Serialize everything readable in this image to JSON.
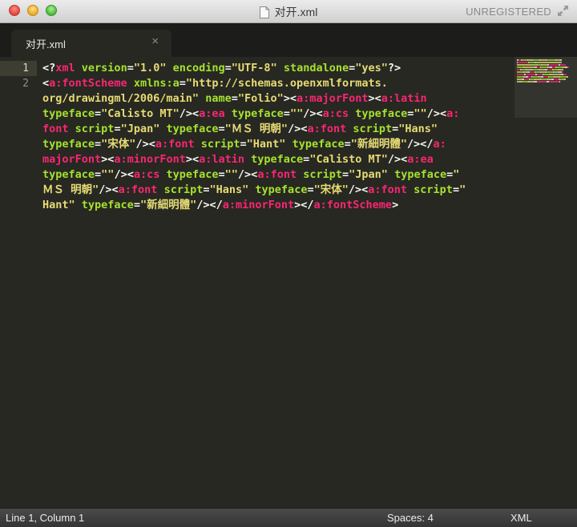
{
  "window": {
    "title": "对开.xml",
    "registration": "UNREGISTERED"
  },
  "tab": {
    "label": "对开.xml",
    "close_glyph": "×"
  },
  "gutter": {
    "line_numbers": [
      "1",
      "2"
    ]
  },
  "code": {
    "lines": [
      [
        [
          "punc",
          "<?"
        ],
        [
          "tag",
          "xml"
        ],
        [
          "punc",
          " "
        ],
        [
          "attr",
          "version"
        ],
        [
          "punc",
          "="
        ],
        [
          "str",
          "\"1.0\""
        ],
        [
          "punc",
          " "
        ],
        [
          "attr",
          "encoding"
        ],
        [
          "punc",
          "="
        ],
        [
          "str",
          "\"UTF-8\""
        ],
        [
          "punc",
          " "
        ],
        [
          "attr",
          "standalone"
        ],
        [
          "punc",
          "="
        ],
        [
          "str",
          "\"yes\""
        ],
        [
          "punc",
          "?>"
        ]
      ],
      [
        [
          "punc",
          "<"
        ],
        [
          "tag",
          "a:fontScheme"
        ],
        [
          "punc",
          " "
        ],
        [
          "attr",
          "xmlns:a"
        ],
        [
          "punc",
          "="
        ],
        [
          "str",
          "\"http://schemas.openxmlformats."
        ]
      ],
      [
        [
          "str",
          "org/drawingml/2006/main\""
        ],
        [
          "punc",
          " "
        ],
        [
          "attr",
          "name"
        ],
        [
          "punc",
          "="
        ],
        [
          "str",
          "\"Folio\""
        ],
        [
          "punc",
          "><"
        ],
        [
          "tag",
          "a:majorFont"
        ],
        [
          "punc",
          "><"
        ],
        [
          "tag",
          "a:latin"
        ]
      ],
      [
        [
          "attr",
          "typeface"
        ],
        [
          "punc",
          "="
        ],
        [
          "str",
          "\"Calisto MT\""
        ],
        [
          "punc",
          "/><"
        ],
        [
          "tag",
          "a:ea"
        ],
        [
          "punc",
          " "
        ],
        [
          "attr",
          "typeface"
        ],
        [
          "punc",
          "="
        ],
        [
          "str",
          "\"\""
        ],
        [
          "punc",
          "/><"
        ],
        [
          "tag",
          "a:cs"
        ],
        [
          "punc",
          " "
        ],
        [
          "attr",
          "typeface"
        ],
        [
          "punc",
          "="
        ],
        [
          "str",
          "\"\""
        ],
        [
          "punc",
          "/><"
        ],
        [
          "tag",
          "a:"
        ]
      ],
      [
        [
          "tag",
          "font"
        ],
        [
          "punc",
          " "
        ],
        [
          "attr",
          "script"
        ],
        [
          "punc",
          "="
        ],
        [
          "str",
          "\"Jpan\""
        ],
        [
          "punc",
          " "
        ],
        [
          "attr",
          "typeface"
        ],
        [
          "punc",
          "="
        ],
        [
          "str",
          "\"ＭＳ 明朝\""
        ],
        [
          "punc",
          "/><"
        ],
        [
          "tag",
          "a:font"
        ],
        [
          "punc",
          " "
        ],
        [
          "attr",
          "script"
        ],
        [
          "punc",
          "="
        ],
        [
          "str",
          "\"Hans\""
        ]
      ],
      [
        [
          "attr",
          "typeface"
        ],
        [
          "punc",
          "="
        ],
        [
          "str",
          "\"宋体\""
        ],
        [
          "punc",
          "/><"
        ],
        [
          "tag",
          "a:font"
        ],
        [
          "punc",
          " "
        ],
        [
          "attr",
          "script"
        ],
        [
          "punc",
          "="
        ],
        [
          "str",
          "\"Hant\""
        ],
        [
          "punc",
          " "
        ],
        [
          "attr",
          "typeface"
        ],
        [
          "punc",
          "="
        ],
        [
          "str",
          "\"新細明體\""
        ],
        [
          "punc",
          "/></"
        ],
        [
          "tag",
          "a:"
        ]
      ],
      [
        [
          "tag",
          "majorFont"
        ],
        [
          "punc",
          "><"
        ],
        [
          "tag",
          "a:minorFont"
        ],
        [
          "punc",
          "><"
        ],
        [
          "tag",
          "a:latin"
        ],
        [
          "punc",
          " "
        ],
        [
          "attr",
          "typeface"
        ],
        [
          "punc",
          "="
        ],
        [
          "str",
          "\"Calisto MT\""
        ],
        [
          "punc",
          "/><"
        ],
        [
          "tag",
          "a:ea"
        ]
      ],
      [
        [
          "attr",
          "typeface"
        ],
        [
          "punc",
          "="
        ],
        [
          "str",
          "\"\""
        ],
        [
          "punc",
          "/><"
        ],
        [
          "tag",
          "a:cs"
        ],
        [
          "punc",
          " "
        ],
        [
          "attr",
          "typeface"
        ],
        [
          "punc",
          "="
        ],
        [
          "str",
          "\"\""
        ],
        [
          "punc",
          "/><"
        ],
        [
          "tag",
          "a:font"
        ],
        [
          "punc",
          " "
        ],
        [
          "attr",
          "script"
        ],
        [
          "punc",
          "="
        ],
        [
          "str",
          "\"Jpan\""
        ],
        [
          "punc",
          " "
        ],
        [
          "attr",
          "typeface"
        ],
        [
          "punc",
          "="
        ],
        [
          "str",
          "\""
        ]
      ],
      [
        [
          "str",
          "ＭＳ 明朝\""
        ],
        [
          "punc",
          "/><"
        ],
        [
          "tag",
          "a:font"
        ],
        [
          "punc",
          " "
        ],
        [
          "attr",
          "script"
        ],
        [
          "punc",
          "="
        ],
        [
          "str",
          "\"Hans\""
        ],
        [
          "punc",
          " "
        ],
        [
          "attr",
          "typeface"
        ],
        [
          "punc",
          "="
        ],
        [
          "str",
          "\"宋体\""
        ],
        [
          "punc",
          "/><"
        ],
        [
          "tag",
          "a:font"
        ],
        [
          "punc",
          " "
        ],
        [
          "attr",
          "script"
        ],
        [
          "punc",
          "="
        ],
        [
          "str",
          "\""
        ]
      ],
      [
        [
          "str",
          "Hant\""
        ],
        [
          "punc",
          " "
        ],
        [
          "attr",
          "typeface"
        ],
        [
          "punc",
          "="
        ],
        [
          "str",
          "\"新細明體\""
        ],
        [
          "punc",
          "/></"
        ],
        [
          "tag",
          "a:minorFont"
        ],
        [
          "punc",
          "></"
        ],
        [
          "tag",
          "a:fontScheme"
        ],
        [
          "punc",
          ">"
        ]
      ]
    ]
  },
  "status": {
    "position": "Line 1, Column 1",
    "indentation": "Spaces: 4",
    "syntax": "XML"
  },
  "colors": {
    "background": "#272822",
    "tag": "#f92672",
    "attribute": "#a6e22e",
    "string": "#e6db74",
    "text": "#f8f8f2"
  }
}
